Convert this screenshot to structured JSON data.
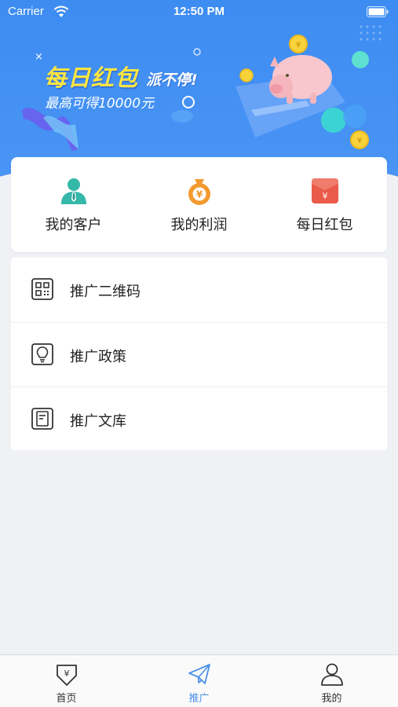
{
  "status_bar": {
    "carrier": "Carrier",
    "time": "12:50 PM"
  },
  "banner": {
    "title": "每日红包",
    "title_suffix": "派不停!",
    "subtitle": "最高可得10000元",
    "title_color": "#ffe640"
  },
  "quick_actions": [
    {
      "label": "我的客户",
      "icon": "customer-icon",
      "color": "#35b7a9"
    },
    {
      "label": "我的利润",
      "icon": "money-bag-icon",
      "color": "#f29a2e"
    },
    {
      "label": "每日红包",
      "icon": "red-envelope-icon",
      "color": "#ea5b4a"
    }
  ],
  "menu": [
    {
      "label": "推广二维码",
      "icon": "qr-code-icon"
    },
    {
      "label": "推广政策",
      "icon": "lightbulb-icon"
    },
    {
      "label": "推广文库",
      "icon": "document-icon"
    }
  ],
  "tabs": [
    {
      "label": "首页",
      "icon": "home-yen-icon",
      "active": false
    },
    {
      "label": "推广",
      "icon": "paper-plane-icon",
      "active": true
    },
    {
      "label": "我的",
      "icon": "user-icon",
      "active": false
    }
  ],
  "colors": {
    "primary": "#4a90e8",
    "banner_bg": "#3d8cf2",
    "page_bg": "#f0f1f4"
  }
}
